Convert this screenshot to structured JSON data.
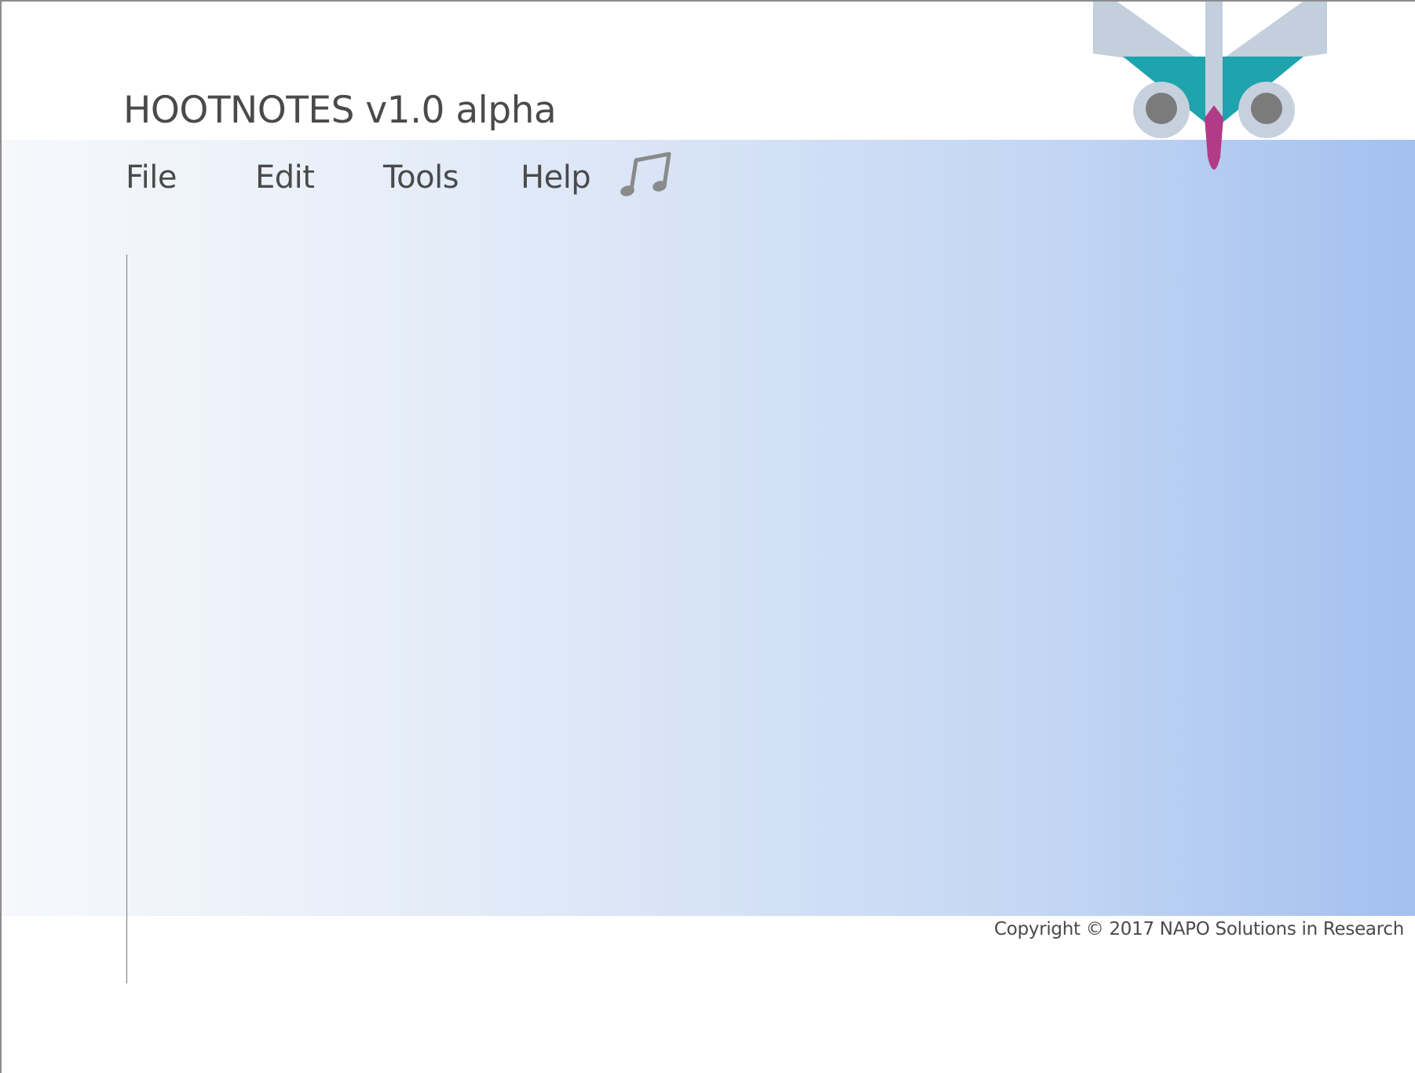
{
  "app": {
    "title": "HOOTNOTES v1.0 alpha"
  },
  "menu": {
    "items": [
      {
        "label": "File"
      },
      {
        "label": "Edit"
      },
      {
        "label": "Tools"
      },
      {
        "label": "Help"
      }
    ],
    "music_icon": "music-note-icon"
  },
  "logo": {
    "icon": "owl-logo-icon",
    "colors": {
      "ears": "#c3cfdc",
      "face": "#1fa3ad",
      "eye_ring": "#c7d1de",
      "pupil": "#7b7b7b",
      "beak": "#b13b86"
    }
  },
  "footer": {
    "copyright": "Copyright © 2017 NAPO Solutions in Research"
  },
  "colors": {
    "text": "#4a4a4a",
    "gradient_start": "#f6f8fb",
    "gradient_end": "#a3c0ef",
    "icon_gray": "#8a8a8a"
  }
}
